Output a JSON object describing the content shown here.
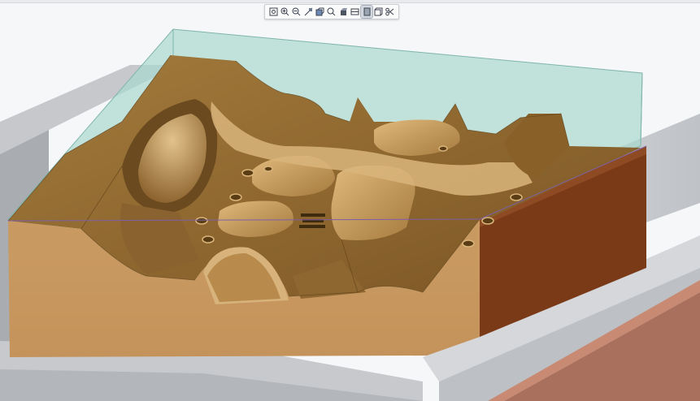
{
  "app": {
    "view": "3d-cad-viewport"
  },
  "toolbar": {
    "tools": [
      {
        "name": "zoom-fit-icon",
        "active": false
      },
      {
        "name": "zoom-in-icon",
        "active": false
      },
      {
        "name": "zoom-out-icon",
        "active": false
      },
      {
        "name": "zoom-window-icon",
        "active": false
      },
      {
        "name": "view-orientation-icon",
        "active": false
      },
      {
        "name": "zoom-area-icon",
        "active": false
      },
      {
        "name": "display-style-icon",
        "active": false
      },
      {
        "name": "section-view-icon",
        "active": false
      },
      {
        "name": "wireframe-mode-icon",
        "active": true
      },
      {
        "name": "cube-view-icon",
        "active": false
      },
      {
        "name": "scissor-cut-icon",
        "active": false
      }
    ]
  },
  "colors": {
    "background": "#f6f7f9",
    "part_top": "#9b7338",
    "part_front": "#c4945c",
    "part_side": "#7a3a18",
    "stock_box": "#a9d8cf",
    "rail": "#cfd1d4",
    "copper_plate": "#a8705d"
  }
}
